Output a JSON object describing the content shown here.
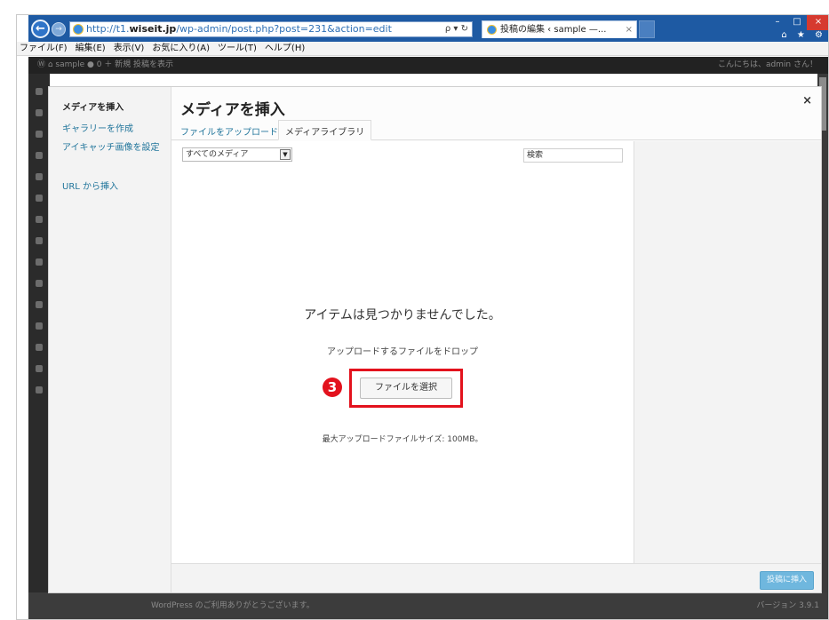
{
  "browser": {
    "url_prefix": "http://t1.",
    "url_domain": "wiseit.jp",
    "url_rest": "/wp-admin/post.php?post=231&action=edit",
    "address_controls": "ρ ▾ ↻",
    "tab_title": "投稿の編集 ‹ sample —...",
    "tab_close": "×",
    "window_controls": [
      "–",
      "□",
      "×"
    ],
    "toolbar_icons": "⌂ ★ ⚙",
    "menu": [
      "ファイル(F)",
      "編集(E)",
      "表示(V)",
      "お気に入り(A)",
      "ツール(T)",
      "ヘルプ(H)"
    ]
  },
  "wp": {
    "adminbar_left": "Ⓦ   ⌂ sample   ● 0   ＋ 新規   投稿を表示",
    "adminbar_right": "こんにちは、admin さん！",
    "footer_left": "WordPress のご利用ありがとうございます。",
    "footer_right": "バージョン 3.9.1"
  },
  "modal": {
    "title": "メディアを挿入",
    "close": "×",
    "sidebar": {
      "heading": "メディアを挿入",
      "links": [
        "ギャラリーを作成",
        "アイキャッチ画像を設定",
        "URL から挿入"
      ]
    },
    "tabs": [
      "ファイルをアップロード",
      "メディアライブラリ"
    ],
    "filter_value": "すべてのメディア",
    "filter_arrow": "▼",
    "search_placeholder": "検索",
    "empty_message": "アイテムは見つかりませんでした。",
    "drop_text": "アップロードするファイルをドロップ",
    "select_button": "ファイルを選択",
    "step_number": "3",
    "max_size": "最大アップロードファイルサイズ: 100MB。",
    "insert_button": "投稿に挿入"
  },
  "colors": {
    "titlebar": "#1e5aa3",
    "link": "#21759b",
    "highlight": "#e3121d",
    "primary_button": "#6fb7de"
  }
}
